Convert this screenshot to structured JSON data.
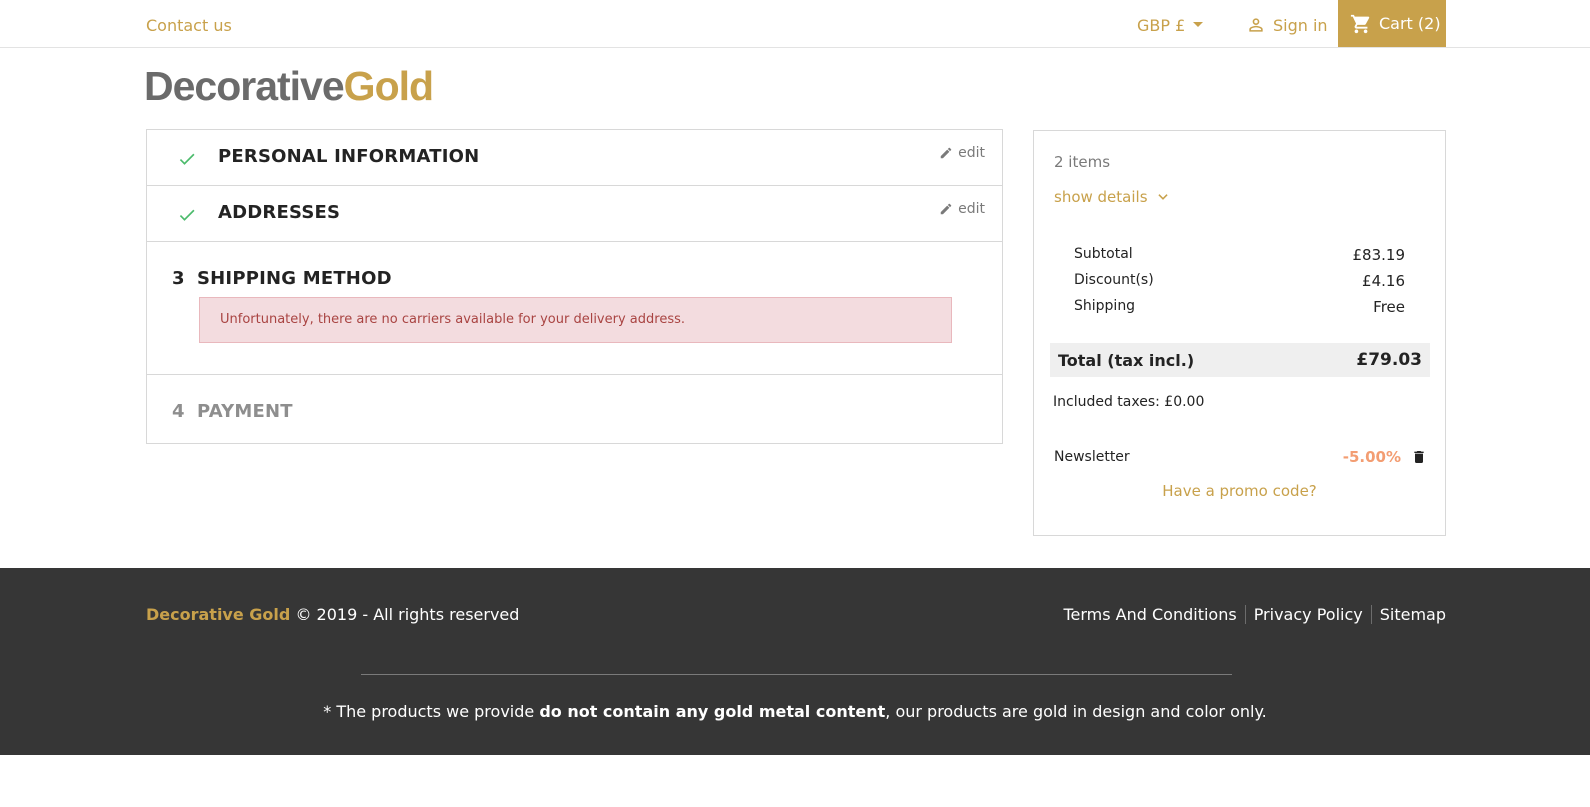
{
  "header": {
    "contact": "Contact us",
    "currency": "GBP £",
    "signin": "Sign in",
    "cart": "Cart (2)"
  },
  "logo": {
    "part1": "Decorative",
    "part2": "Gold"
  },
  "steps": [
    {
      "title": "PERSONAL INFORMATION",
      "edit": "edit",
      "status": "complete"
    },
    {
      "title": "ADDRESSES",
      "edit": "edit",
      "status": "complete"
    },
    {
      "num": "3",
      "title": "SHIPPING METHOD",
      "status": "current",
      "alert": "Unfortunately, there are no carriers available for your delivery address."
    },
    {
      "num": "4",
      "title": "PAYMENT",
      "status": "pending"
    }
  ],
  "summary": {
    "items": "2 items",
    "show_details": "show details",
    "subtotal_label": "Subtotal",
    "subtotal": "£83.19",
    "discount_label": "Discount(s)",
    "discount": "£4.16",
    "shipping_label": "Shipping",
    "shipping": "Free",
    "total_label": "Total (tax incl.)",
    "total": "£79.03",
    "taxes": "Included taxes: £0.00",
    "voucher_name": "Newsletter",
    "voucher_value": "-5.00%",
    "promo": "Have a promo code?"
  },
  "footer": {
    "brand": "Decorative Gold",
    "copyright": "© 2019 - All rights reserved",
    "links": [
      "Terms And Conditions",
      "Privacy Policy",
      "Sitemap"
    ],
    "disclaimer_pre": "* The products we provide ",
    "disclaimer_bold": "do not contain any gold metal content",
    "disclaimer_post": ", our products are gold in design and color only."
  },
  "colors": {
    "accent": "#c8a14b",
    "success": "#4cbb6c",
    "alert_bg": "#f3dcdf",
    "alert_text": "#a94442",
    "discount": "#f39d72",
    "footer_bg": "#363636"
  }
}
